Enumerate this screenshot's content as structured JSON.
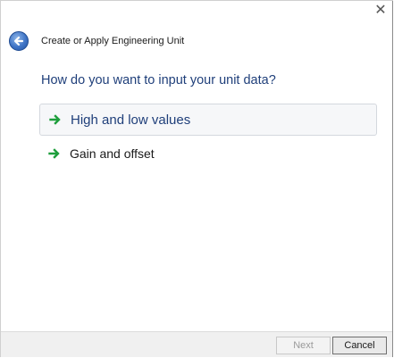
{
  "window": {
    "close_glyph": "✕",
    "title": "Create or Apply Engineering Unit"
  },
  "question": "How do you want to input your unit data?",
  "options": [
    {
      "label": "High and low values",
      "selected": true,
      "icon": "green-arrow-icon"
    },
    {
      "label": "Gain and offset",
      "selected": false,
      "icon": "green-arrow-icon"
    }
  ],
  "footer": {
    "next_label": "Next",
    "cancel_label": "Cancel"
  },
  "colors": {
    "accent_text": "#1f3f7a",
    "arrow_green": "#1e9e3c",
    "back_button": "#3f74c6"
  }
}
